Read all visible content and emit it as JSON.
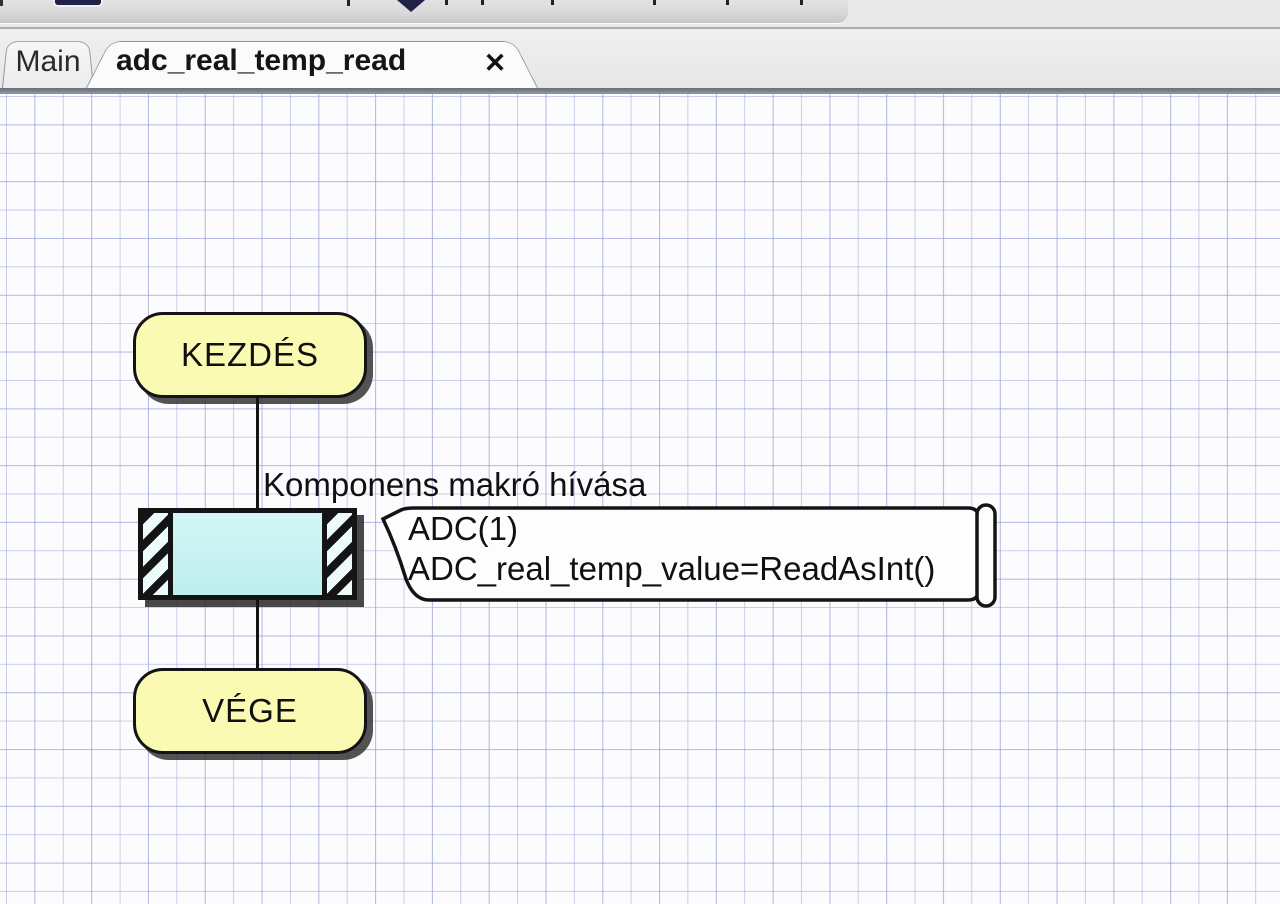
{
  "tabs": {
    "items": [
      {
        "label": "Main",
        "active": false
      },
      {
        "label": "adc_real_temp_read",
        "active": true
      }
    ],
    "close_glyph": "✕"
  },
  "flowchart": {
    "start_label": "KEZDÉS",
    "end_label": "VÉGE",
    "macro_call_title": "Komponens makró hívása",
    "callout": {
      "lines": [
        "ADC(1)",
        "ADC_real_temp_value=ReadAsInt()"
      ]
    }
  },
  "colors": {
    "terminal_fill": "#FAFAB2",
    "macro_fill": "#C6F1F1",
    "grid_line": "#C5CDE8",
    "canvas_bg": "#FCFCFE",
    "shadow": "#2D2D2D"
  }
}
